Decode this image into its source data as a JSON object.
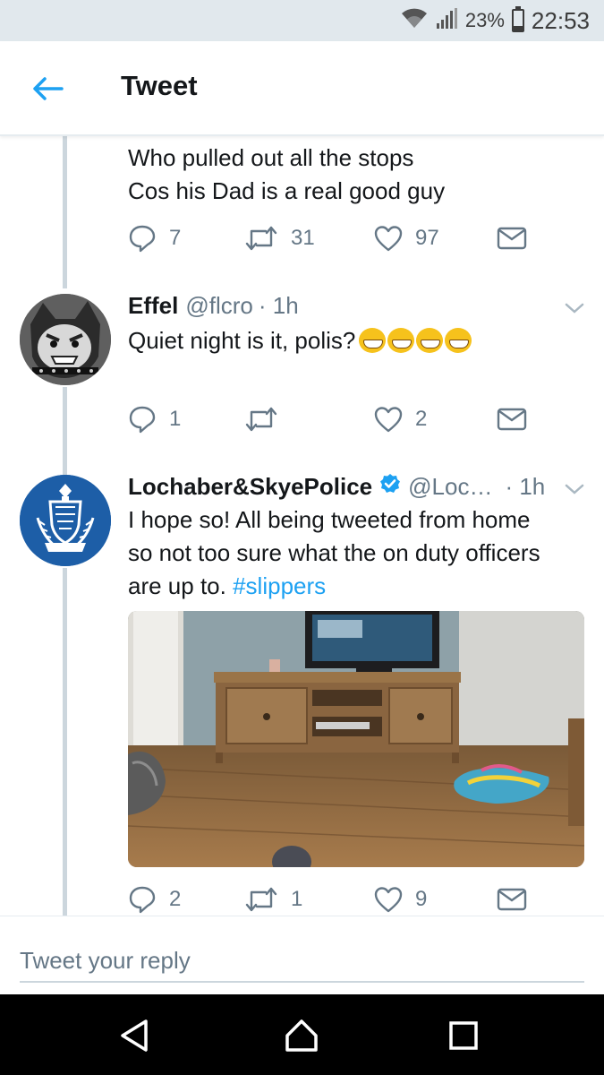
{
  "status_bar": {
    "battery_percent": "23%",
    "battery_level": 0.23,
    "time": "22:53",
    "icons": [
      "wifi-icon",
      "signal-icon",
      "battery-icon"
    ]
  },
  "app_bar": {
    "title": "Tweet",
    "back_icon": "arrow-left-icon"
  },
  "colors": {
    "accent": "#1da1f2",
    "text_primary": "#14171a",
    "text_secondary": "#657786",
    "thread_line": "#ccd6dd",
    "verified": "#1da1f2"
  },
  "tweets": [
    {
      "text_lines": [
        "Who pulled out all the stops",
        "Cos his Dad is a real good guy"
      ],
      "actions": {
        "replies": "7",
        "retweets": "31",
        "likes": "97"
      }
    },
    {
      "display_name": "Effel",
      "handle": "@flcro",
      "time": "· 1h",
      "text": "Quiet night is it, polis?",
      "emoji_count": 4,
      "emoji_name": "grinning-squinting-face-emoji",
      "actions": {
        "replies": "1",
        "retweets": "",
        "likes": "2"
      }
    },
    {
      "display_name": "Lochaber&SkyePolice",
      "handle": "@Loc…",
      "time": "· 1h",
      "verified": true,
      "text_lines": [
        "I hope so! All being tweeted from home",
        "so not too sure what the on duty officers"
      ],
      "text_line3": "are up to.",
      "hashtag": "#slippers",
      "media": "photo-living-room-tv-stand",
      "actions": {
        "replies": "2",
        "retweets": "1",
        "likes": "9"
      }
    }
  ],
  "reply": {
    "placeholder": "Tweet your reply"
  },
  "nav_bar": {
    "buttons": [
      "back-triangle-icon",
      "home-circle-icon",
      "recents-square-icon"
    ]
  }
}
